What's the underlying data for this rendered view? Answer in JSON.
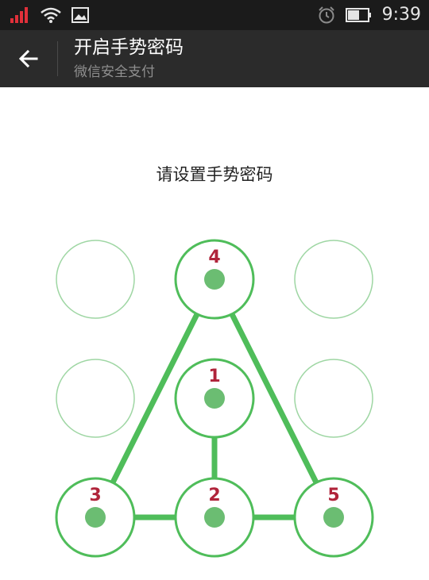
{
  "status_bar": {
    "time": "9:39",
    "icons": [
      "signal-icon",
      "wifi-icon",
      "image-notification-icon",
      "alarm-icon",
      "battery-icon"
    ],
    "signal_color": "#e0303a"
  },
  "app_bar": {
    "back_icon": "arrow-left-icon",
    "title": "开启手势密码",
    "subtitle": "微信安全支付"
  },
  "prompt": "请设置手势密码",
  "pattern": {
    "color_line": "#4fbd5a",
    "color_ring_selected": "#4fbd5a",
    "color_ring_idle": "#9ed6a3",
    "color_dot": "#6bbd72",
    "color_label": "#b0243a",
    "nodes": [
      {
        "row": 0,
        "col": 0,
        "selected": false,
        "label": ""
      },
      {
        "row": 0,
        "col": 1,
        "selected": true,
        "label": "4"
      },
      {
        "row": 0,
        "col": 2,
        "selected": false,
        "label": ""
      },
      {
        "row": 1,
        "col": 0,
        "selected": false,
        "label": ""
      },
      {
        "row": 1,
        "col": 1,
        "selected": true,
        "label": "1"
      },
      {
        "row": 1,
        "col": 2,
        "selected": false,
        "label": ""
      },
      {
        "row": 2,
        "col": 0,
        "selected": true,
        "label": "3"
      },
      {
        "row": 2,
        "col": 1,
        "selected": true,
        "label": "2"
      },
      {
        "row": 2,
        "col": 2,
        "selected": true,
        "label": "5"
      }
    ],
    "sequence": [
      [
        1,
        1
      ],
      [
        2,
        1
      ],
      [
        2,
        0
      ],
      [
        0,
        1
      ],
      [
        2,
        2
      ],
      [
        2,
        1
      ]
    ]
  }
}
